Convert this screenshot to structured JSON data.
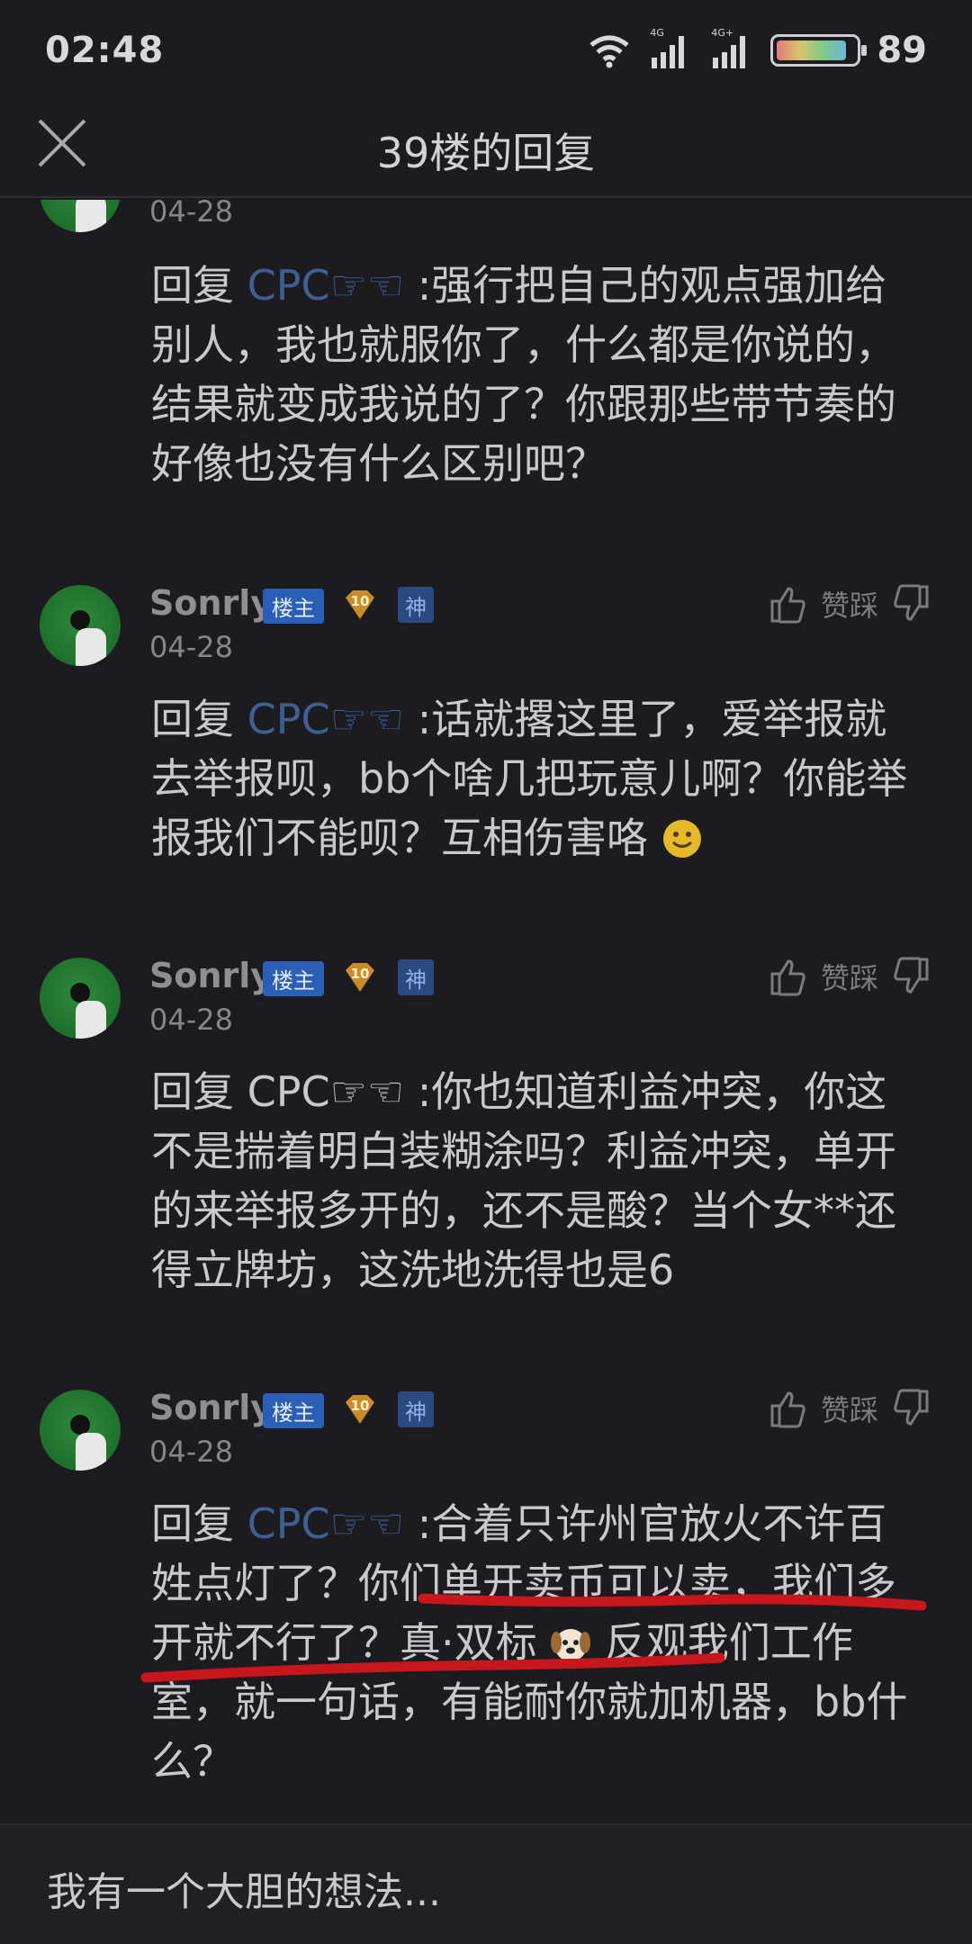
{
  "status_bar": {
    "time": "02:48",
    "net1": "4G",
    "net2": "4G+",
    "battery": "89"
  },
  "header": {
    "title": "39楼的回复"
  },
  "posts": [
    {
      "date": "04-28",
      "reply_prefix": "回复",
      "mention": "CPC☞☜",
      "text": ":强行把自己的观点强加给别人，我也就服你了，什么都是你说的，结果就变成我说的了？你跟那些带节奏的好像也没有什么区别吧？"
    },
    {
      "username": "Sonrly",
      "owner_badge": "楼主",
      "level": "10",
      "god_badge": "神",
      "date": "04-28",
      "vote_label": "赞踩",
      "reply_prefix": "回复",
      "mention": "CPC☞☜",
      "text": ":话就撂这里了，爱举报就去举报呗，bb个啥几把玩意儿啊？你能举报我们不能呗？互相伤害咯"
    },
    {
      "username": "Sonrly",
      "owner_badge": "楼主",
      "level": "10",
      "god_badge": "神",
      "date": "04-28",
      "vote_label": "赞踩",
      "reply_prefix": "回复",
      "mention": "CPC☞☜",
      "text": ":你也知道利益冲突，你这不是揣着明白装糊涂吗？利益冲突，单开的来举报多开的，还不是酸？当个女**还得立牌坊，这洗地洗得也是6"
    },
    {
      "username": "Sonrly",
      "owner_badge": "楼主",
      "level": "10",
      "god_badge": "神",
      "date": "04-28",
      "vote_label": "赞踩",
      "reply_prefix": "回复",
      "mention": "CPC☞☜",
      "text_a": ":合着只许州官放火不许百姓点灯了？你们单开卖币可以卖，我们多开就不行了？真·双标",
      "text_b": "反观我们工作室，就一句话，有能耐你就加机器，bb什么？"
    }
  ],
  "bottom_bar": {
    "placeholder": "我有一个大胆的想法..."
  },
  "colors": {
    "background": "#1b1b20",
    "mention": "#3f5f92",
    "owner_badge": "#2a5fb5",
    "annotation_red": "#c8161d"
  }
}
